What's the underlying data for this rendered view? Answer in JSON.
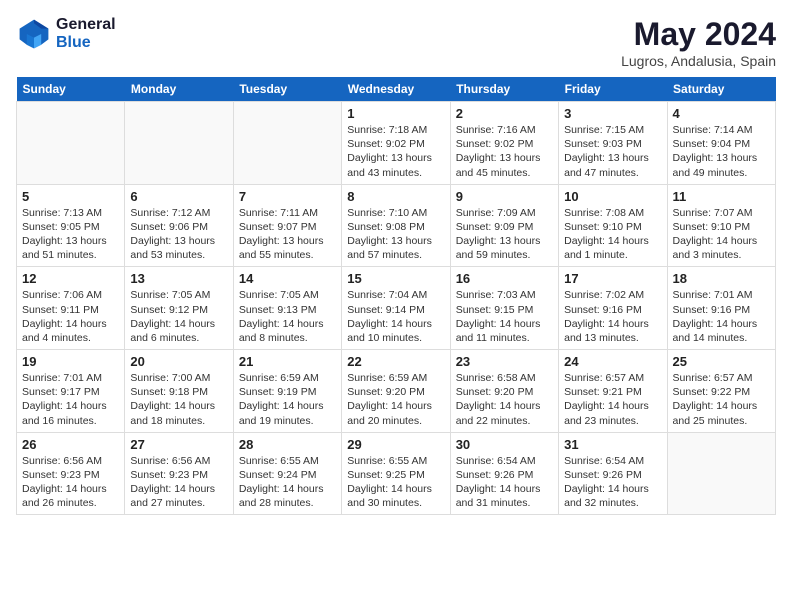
{
  "header": {
    "logo_line1": "General",
    "logo_line2": "Blue",
    "month": "May 2024",
    "location": "Lugros, Andalusia, Spain"
  },
  "weekdays": [
    "Sunday",
    "Monday",
    "Tuesday",
    "Wednesday",
    "Thursday",
    "Friday",
    "Saturday"
  ],
  "weeks": [
    [
      {
        "day": "",
        "info": ""
      },
      {
        "day": "",
        "info": ""
      },
      {
        "day": "",
        "info": ""
      },
      {
        "day": "1",
        "info": "Sunrise: 7:18 AM\nSunset: 9:02 PM\nDaylight: 13 hours\nand 43 minutes."
      },
      {
        "day": "2",
        "info": "Sunrise: 7:16 AM\nSunset: 9:02 PM\nDaylight: 13 hours\nand 45 minutes."
      },
      {
        "day": "3",
        "info": "Sunrise: 7:15 AM\nSunset: 9:03 PM\nDaylight: 13 hours\nand 47 minutes."
      },
      {
        "day": "4",
        "info": "Sunrise: 7:14 AM\nSunset: 9:04 PM\nDaylight: 13 hours\nand 49 minutes."
      }
    ],
    [
      {
        "day": "5",
        "info": "Sunrise: 7:13 AM\nSunset: 9:05 PM\nDaylight: 13 hours\nand 51 minutes."
      },
      {
        "day": "6",
        "info": "Sunrise: 7:12 AM\nSunset: 9:06 PM\nDaylight: 13 hours\nand 53 minutes."
      },
      {
        "day": "7",
        "info": "Sunrise: 7:11 AM\nSunset: 9:07 PM\nDaylight: 13 hours\nand 55 minutes."
      },
      {
        "day": "8",
        "info": "Sunrise: 7:10 AM\nSunset: 9:08 PM\nDaylight: 13 hours\nand 57 minutes."
      },
      {
        "day": "9",
        "info": "Sunrise: 7:09 AM\nSunset: 9:09 PM\nDaylight: 13 hours\nand 59 minutes."
      },
      {
        "day": "10",
        "info": "Sunrise: 7:08 AM\nSunset: 9:10 PM\nDaylight: 14 hours\nand 1 minute."
      },
      {
        "day": "11",
        "info": "Sunrise: 7:07 AM\nSunset: 9:10 PM\nDaylight: 14 hours\nand 3 minutes."
      }
    ],
    [
      {
        "day": "12",
        "info": "Sunrise: 7:06 AM\nSunset: 9:11 PM\nDaylight: 14 hours\nand 4 minutes."
      },
      {
        "day": "13",
        "info": "Sunrise: 7:05 AM\nSunset: 9:12 PM\nDaylight: 14 hours\nand 6 minutes."
      },
      {
        "day": "14",
        "info": "Sunrise: 7:05 AM\nSunset: 9:13 PM\nDaylight: 14 hours\nand 8 minutes."
      },
      {
        "day": "15",
        "info": "Sunrise: 7:04 AM\nSunset: 9:14 PM\nDaylight: 14 hours\nand 10 minutes."
      },
      {
        "day": "16",
        "info": "Sunrise: 7:03 AM\nSunset: 9:15 PM\nDaylight: 14 hours\nand 11 minutes."
      },
      {
        "day": "17",
        "info": "Sunrise: 7:02 AM\nSunset: 9:16 PM\nDaylight: 14 hours\nand 13 minutes."
      },
      {
        "day": "18",
        "info": "Sunrise: 7:01 AM\nSunset: 9:16 PM\nDaylight: 14 hours\nand 14 minutes."
      }
    ],
    [
      {
        "day": "19",
        "info": "Sunrise: 7:01 AM\nSunset: 9:17 PM\nDaylight: 14 hours\nand 16 minutes."
      },
      {
        "day": "20",
        "info": "Sunrise: 7:00 AM\nSunset: 9:18 PM\nDaylight: 14 hours\nand 18 minutes."
      },
      {
        "day": "21",
        "info": "Sunrise: 6:59 AM\nSunset: 9:19 PM\nDaylight: 14 hours\nand 19 minutes."
      },
      {
        "day": "22",
        "info": "Sunrise: 6:59 AM\nSunset: 9:20 PM\nDaylight: 14 hours\nand 20 minutes."
      },
      {
        "day": "23",
        "info": "Sunrise: 6:58 AM\nSunset: 9:20 PM\nDaylight: 14 hours\nand 22 minutes."
      },
      {
        "day": "24",
        "info": "Sunrise: 6:57 AM\nSunset: 9:21 PM\nDaylight: 14 hours\nand 23 minutes."
      },
      {
        "day": "25",
        "info": "Sunrise: 6:57 AM\nSunset: 9:22 PM\nDaylight: 14 hours\nand 25 minutes."
      }
    ],
    [
      {
        "day": "26",
        "info": "Sunrise: 6:56 AM\nSunset: 9:23 PM\nDaylight: 14 hours\nand 26 minutes."
      },
      {
        "day": "27",
        "info": "Sunrise: 6:56 AM\nSunset: 9:23 PM\nDaylight: 14 hours\nand 27 minutes."
      },
      {
        "day": "28",
        "info": "Sunrise: 6:55 AM\nSunset: 9:24 PM\nDaylight: 14 hours\nand 28 minutes."
      },
      {
        "day": "29",
        "info": "Sunrise: 6:55 AM\nSunset: 9:25 PM\nDaylight: 14 hours\nand 30 minutes."
      },
      {
        "day": "30",
        "info": "Sunrise: 6:54 AM\nSunset: 9:26 PM\nDaylight: 14 hours\nand 31 minutes."
      },
      {
        "day": "31",
        "info": "Sunrise: 6:54 AM\nSunset: 9:26 PM\nDaylight: 14 hours\nand 32 minutes."
      },
      {
        "day": "",
        "info": ""
      }
    ]
  ]
}
